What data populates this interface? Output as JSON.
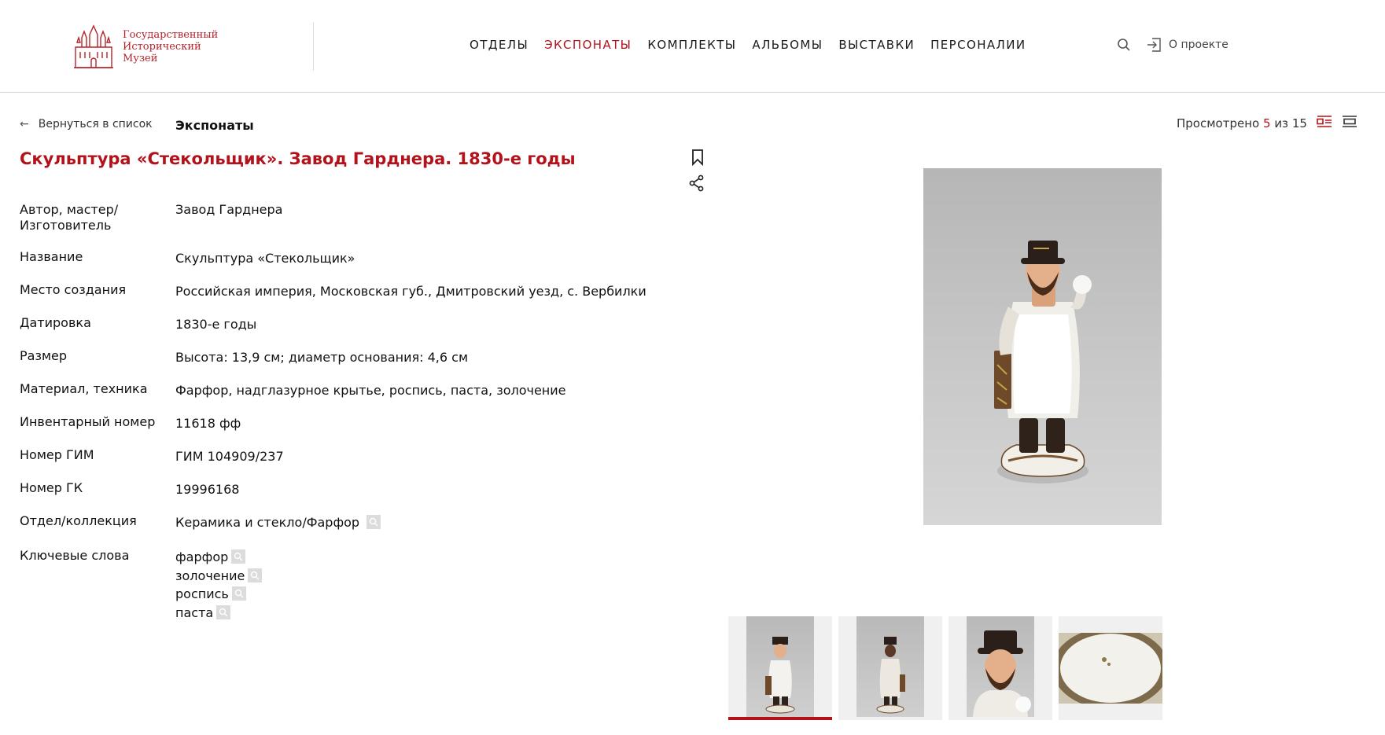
{
  "brand": {
    "logo_lines": [
      "Государственный",
      "Исторический",
      "Музей"
    ],
    "accent_color": "#b3121b"
  },
  "nav": {
    "items": [
      {
        "label": "ОТДЕЛЫ",
        "active": false
      },
      {
        "label": "ЭКСПОНАТЫ",
        "active": true
      },
      {
        "label": "КОМПЛЕКТЫ",
        "active": false
      },
      {
        "label": "АЛЬБОМЫ",
        "active": false
      },
      {
        "label": "ВЫСТАВКИ",
        "active": false
      },
      {
        "label": "ПЕРСОНАЛИИ",
        "active": false
      }
    ],
    "about_label": "О проекте"
  },
  "subheader": {
    "back_label": "Вернуться в список",
    "back_arrow": "←",
    "section_title": "Экспонаты",
    "viewed_prefix": "Просмотрено",
    "viewed_current": "5",
    "viewed_sep": "из",
    "viewed_total": "15"
  },
  "object": {
    "title": "Скульптура «Стекольщик». Завод Гарднера. 1830-е годы",
    "fields": [
      {
        "label": "Автор, мастер/ Изготовитель",
        "value": "Завод Гарднера"
      },
      {
        "label": "Название",
        "value": "Скульптура «Стекольщик»"
      },
      {
        "label": "Место создания",
        "value": "Российская империя, Московская губ., Дмитровский уезд, с. Вербилки"
      },
      {
        "label": "Датировка",
        "value": "1830-е годы"
      },
      {
        "label": "Размер",
        "value": "Высота: 13,9 см; диаметр основания: 4,6 см"
      },
      {
        "label": "Материал, техника",
        "value": "Фарфор, надглазурное крытье, роспись, паста, золочение"
      },
      {
        "label": "Инвентарный номер",
        "value": "11618 фф"
      },
      {
        "label": "Номер ГИМ",
        "value": "ГИМ 104909/237"
      },
      {
        "label": "Номер ГК",
        "value": "19996168"
      },
      {
        "label": "Отдел/коллекция",
        "value": "Керамика и стекло/Фарфор"
      }
    ],
    "keywords_label": "Ключевые слова",
    "keywords": [
      "фарфор",
      "золочение",
      "роспись",
      "паста"
    ]
  },
  "gallery": {
    "thumbnails_count": 4,
    "active_index": 0
  }
}
